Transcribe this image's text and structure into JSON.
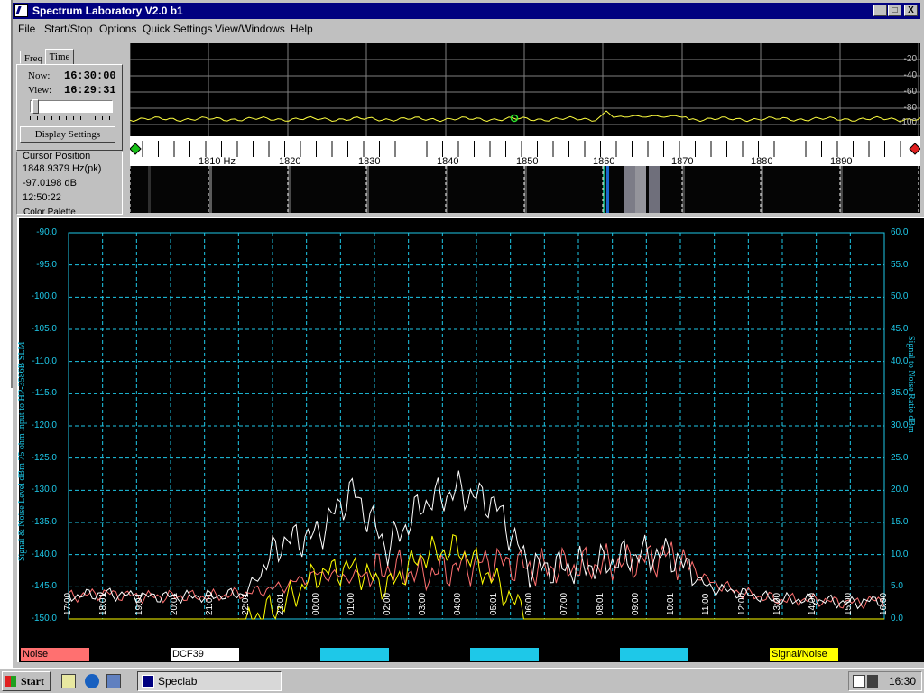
{
  "window": {
    "title": "Spectrum Laboratory V2.0 b1",
    "min_label": "_",
    "max_label": "□",
    "close_label": "X"
  },
  "menu": [
    "File",
    "Start/Stop",
    "Options",
    "Quick Settings",
    "View/Windows",
    "Help"
  ],
  "left_panel": {
    "tabs": [
      "Freq",
      "Time"
    ],
    "now_label": "Now:",
    "now_value": "16:30:00",
    "view_label": "View:",
    "view_value": "16:29:31",
    "display_settings_label": "Display Settings",
    "cursor_title": "Cursor Position",
    "cursor_freq": "1848.9379 Hz(pk)",
    "cursor_db": "-97.0198 dB",
    "cursor_time": "12:50:22",
    "color_palette_label": "Color Palette"
  },
  "spectrum": {
    "db_ticks": [
      "-20",
      "-40",
      "-60",
      "-80",
      "-100"
    ],
    "freq_ticks": [
      "1810 Hz",
      "1820",
      "1830",
      "1840",
      "1850",
      "1860",
      "1870",
      "1880",
      "1890"
    ]
  },
  "plot": {
    "left_axis_label": "Signal & Noise Level  dBm 75 ohm input to HP-3586B SLM",
    "right_axis_label": "Signal to Noise Ratio   dBm",
    "left_ticks": [
      "-90.0",
      "-95.0",
      "-100.0",
      "-105.0",
      "-110.0",
      "-115.0",
      "-120.0",
      "-125.0",
      "-130.0",
      "-135.0",
      "-140.0",
      "-145.0",
      "-150.0"
    ],
    "right_ticks": [
      "60.0",
      "55.0",
      "50.0",
      "45.0",
      "40.0",
      "35.0",
      "30.0",
      "25.0",
      "20.0",
      "15.0",
      "10.0",
      "5.0",
      "0.0"
    ],
    "time_ticks": [
      "17:00",
      "18:01",
      "19:01",
      "20:01",
      "21:01",
      "22:01",
      "23:01",
      "00:00",
      "01:00",
      "02:00",
      "03:00",
      "04:00",
      "05:01",
      "06:00",
      "07:00",
      "08:01",
      "09:00",
      "10:01",
      "11:00",
      "12:00",
      "13:00",
      "14:00",
      "15:00",
      "16:00"
    ],
    "colors": {
      "axis": "#1ec8e8",
      "noise": "#ff7070",
      "signal": "#ffffff",
      "snr": "#ffff00"
    }
  },
  "legend": [
    "Noise",
    "DCF39",
    "",
    "",
    "",
    "Signal/Noise"
  ],
  "taskbar": {
    "start_label": "Start",
    "task_label": "Speclab",
    "clock": "16:30"
  },
  "chart_data": {
    "type": "line",
    "xlabel": "",
    "ylabel": "Signal & Noise Level  dBm 75 ohm input to HP-3586B SLM",
    "y2label": "Signal to Noise Ratio   dBm",
    "ylim": [
      -150,
      -90
    ],
    "y2lim": [
      0,
      60
    ],
    "categories": [
      "17:00",
      "18:01",
      "19:01",
      "20:01",
      "21:01",
      "22:01",
      "23:01",
      "00:00",
      "01:00",
      "02:00",
      "03:00",
      "04:00",
      "05:01",
      "06:00",
      "07:00",
      "08:01",
      "09:00",
      "10:01",
      "11:00",
      "12:00",
      "13:00",
      "14:00",
      "15:00",
      "16:00"
    ],
    "series": [
      {
        "name": "Noise",
        "axis": "left",
        "values": [
          -146.5,
          -146,
          -146.5,
          -146.5,
          -146.5,
          -146,
          -145,
          -143,
          -143.5,
          -142,
          -143,
          -142,
          -141,
          -142,
          -142,
          -141.5,
          -141,
          -140,
          -144,
          -146,
          -147,
          -147,
          -147.5,
          -147
        ]
      },
      {
        "name": "DCF39",
        "axis": "left",
        "values": [
          -146.5,
          -146,
          -146.5,
          -146.5,
          -146.5,
          -146,
          -138,
          -137,
          -130,
          -139,
          -132,
          -130,
          -132,
          -142,
          -142,
          -141.5,
          -140,
          -140,
          -145,
          -146,
          -147,
          -147,
          -147.5,
          -147
        ]
      },
      {
        "name": "Signal/Noise",
        "axis": "right",
        "values": [
          0,
          0,
          0,
          0,
          0,
          0,
          2,
          7,
          8,
          5,
          10,
          11,
          6,
          0,
          0,
          0,
          0,
          0,
          0,
          0,
          0,
          0,
          0,
          0
        ]
      }
    ],
    "grid": true
  }
}
